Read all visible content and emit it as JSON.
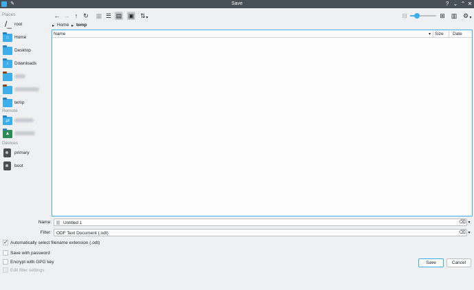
{
  "window": {
    "title": "Save",
    "controls": [
      "help-icon",
      "minimize-icon",
      "maximize-icon",
      "close-icon"
    ]
  },
  "sidebar": {
    "places_label": "Places",
    "places": [
      {
        "label": "root",
        "icon": "root-icon"
      },
      {
        "label": "Home",
        "icon": "home-folder-icon"
      },
      {
        "label": "Desktop",
        "icon": "desktop-folder-icon"
      },
      {
        "label": "Downloads",
        "icon": "downloads-folder-icon"
      },
      {
        "label": "",
        "icon": "folder-icon"
      },
      {
        "label": "",
        "icon": "folder-icon"
      },
      {
        "label": "temp",
        "icon": "folder-icon"
      }
    ],
    "remote_label": "Remote",
    "remote": [
      {
        "label": "",
        "icon": "network-folder-icon"
      },
      {
        "label": "",
        "icon": "remote-folder-icon"
      }
    ],
    "devices_label": "Devices",
    "devices": [
      {
        "label": "primary",
        "icon": "drive-icon"
      },
      {
        "label": "boot",
        "icon": "drive-icon"
      }
    ]
  },
  "toolbar": {
    "back": "←",
    "forward": "→",
    "up": "↑",
    "reload": "↻",
    "zoom_level": 0.2
  },
  "breadcrumb": {
    "items": [
      "Home",
      "temp"
    ]
  },
  "filelist": {
    "columns": [
      "Name",
      "Size",
      "Date"
    ]
  },
  "form": {
    "name_label": "Name:",
    "name_value": "Untitled 1",
    "filter_label": "Filter:",
    "filter_value": "ODF Text Document (.odt)"
  },
  "options": [
    {
      "label": "Automatically select filename extension (.odt)",
      "checked": true,
      "enabled": true
    },
    {
      "label": "Save with password",
      "checked": false,
      "enabled": true
    },
    {
      "label": "Encrypt with GPG key",
      "checked": false,
      "enabled": true
    },
    {
      "label": "Edit filter settings",
      "checked": false,
      "enabled": false
    }
  ],
  "buttons": {
    "save": "Save",
    "cancel": "Cancel"
  }
}
